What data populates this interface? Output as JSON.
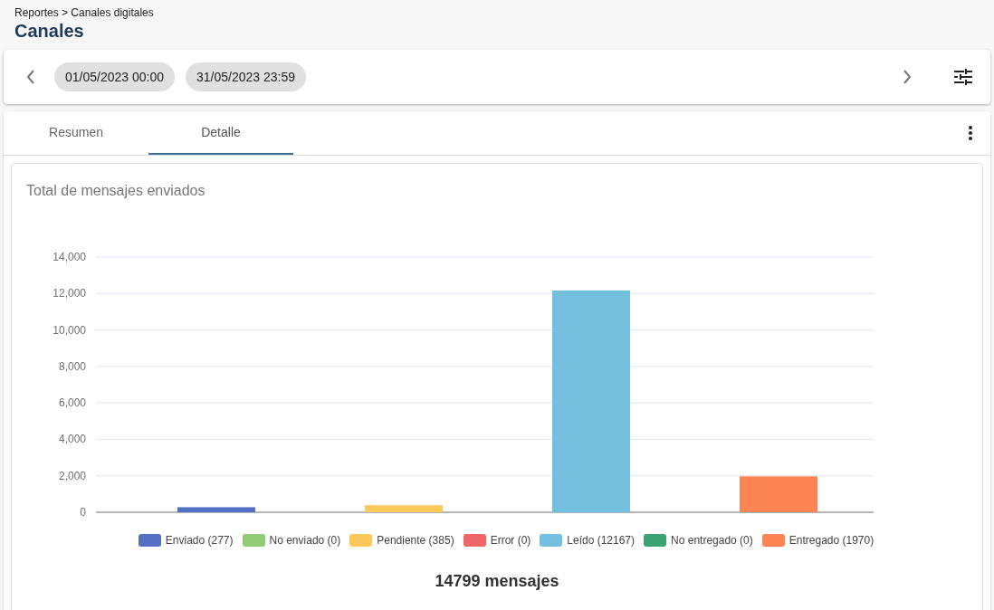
{
  "breadcrumb": "Reportes > Canales digitales",
  "title": "Canales",
  "date_range": {
    "start": "01/05/2023 00:00",
    "end": "31/05/2023 23:59"
  },
  "tabs": [
    {
      "label": "Resumen",
      "selected": false
    },
    {
      "label": "Detalle",
      "selected": true
    }
  ],
  "chart_card": {
    "title": "Total de mensajes enviados",
    "chart_data": {
      "type": "bar",
      "grid": true,
      "legend": true,
      "ylim": [
        0,
        14000
      ],
      "yticks": [
        {
          "value": 0,
          "label": "0"
        },
        {
          "value": 2000,
          "label": "2,000"
        },
        {
          "value": 4000,
          "label": "4,000"
        },
        {
          "value": 6000,
          "label": "6,000"
        },
        {
          "value": 8000,
          "label": "8,000"
        },
        {
          "value": 10000,
          "label": "10,000"
        },
        {
          "value": 12000,
          "label": "12,000"
        },
        {
          "value": 14000,
          "label": "14,000"
        }
      ],
      "series": [
        {
          "name": "Enviado (277)",
          "color": "#5470c6",
          "values": [
            277
          ]
        },
        {
          "name": "No enviado (0)",
          "color": "#91cc75",
          "values": [
            0
          ]
        },
        {
          "name": "Pendiente (385)",
          "color": "#fac858",
          "values": [
            385
          ]
        },
        {
          "name": "Error (0)",
          "color": "#ee6666",
          "values": [
            0
          ]
        },
        {
          "name": "Leído (12167)",
          "color": "#73c0de",
          "values": [
            12167
          ]
        },
        {
          "name": "No entregado (0)",
          "color": "#3ba272",
          "values": [
            0
          ]
        },
        {
          "name": "Entregado (1970)",
          "color": "#fc8452",
          "values": [
            1970
          ]
        }
      ]
    },
    "total": "14799 mensajes"
  }
}
